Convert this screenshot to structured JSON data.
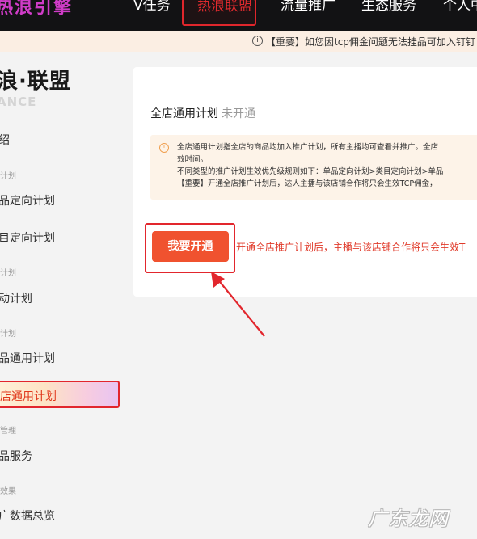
{
  "topnav": {
    "logo": "热浪引擎",
    "items": [
      "V任务",
      "热浪联盟",
      "流量推广",
      "生态服务",
      "个人中"
    ],
    "active_index": 1
  },
  "notice": {
    "icon": "info-icon",
    "text": "【重要】如您因tcp佣金问题无法挂品可加入钉钉"
  },
  "sidebar": {
    "brand": "浪·联盟",
    "brand_sub": "ANCE",
    "groups": [
      "计划",
      "计划",
      "计划",
      "管理",
      "效果"
    ],
    "items": [
      "绍",
      "品定向计划",
      "目定向计划",
      "动计划",
      "品通用计划",
      "店通用计划",
      "品服务",
      "广数据总览"
    ],
    "active_item": "店通用计划"
  },
  "main": {
    "title": "全店通用计划",
    "status": "未开通",
    "tips": [
      "全店通用计划指全店的商品均加入推广计划，所有主播均可查看并推广。全店",
      "效时间。",
      "不同类型的推广计划生效优先级规则如下：单品定向计划>类目定向计划>单品",
      "【重要】开通全店推广计划后，达人主播与该店铺合作将只会生效TCP佣金，"
    ],
    "open_button": "我要开通",
    "open_hint": "开通全店推广计划后，主播与该店铺合作将只会生效T"
  },
  "watermark": "广东龙网",
  "colors": {
    "nav_bg": "#121214",
    "highlight_red": "#e2262d",
    "primary_button": "#f0522f",
    "notice_bg": "#fbeee3",
    "tips_bg": "#fdf3e8"
  }
}
